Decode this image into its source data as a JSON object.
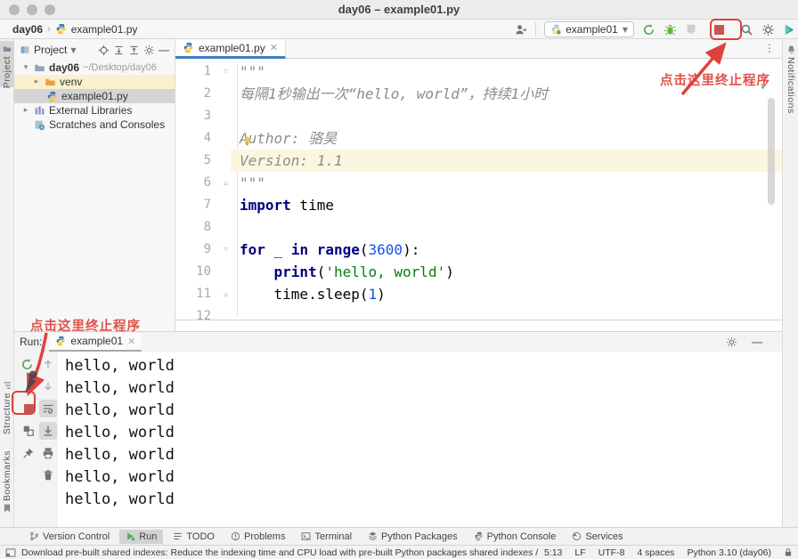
{
  "window": {
    "title": "day06 – example01.py"
  },
  "navbar": {
    "breadcrumb_project": "day06",
    "breadcrumb_file": "example01.py",
    "run_config": "example01"
  },
  "project_panel": {
    "title": "Project",
    "tree": [
      {
        "label": "day06",
        "path": "~/Desktop/day06"
      },
      {
        "label": "venv"
      },
      {
        "label": "example01.py"
      },
      {
        "label": "External Libraries"
      },
      {
        "label": "Scratches and Consoles"
      }
    ]
  },
  "tool_strips": {
    "left": [
      "Project",
      "Structure",
      "Bookmarks"
    ],
    "right": [
      "Notifications"
    ]
  },
  "editor": {
    "tab_title": "example01.py",
    "lines": [
      {
        "n": "1",
        "fold": "down",
        "segs": [
          [
            "\"\"\"",
            "str"
          ]
        ]
      },
      {
        "n": "2",
        "segs": [
          [
            "每隔1秒输出一次“hello, world”，持续1小时",
            "str"
          ]
        ]
      },
      {
        "n": "3",
        "segs": []
      },
      {
        "n": "4",
        "segs": [
          [
            "Author: 骆昊",
            "str"
          ]
        ]
      },
      {
        "n": "5",
        "hl": true,
        "segs": [
          [
            "Version: 1.1",
            "str"
          ]
        ]
      },
      {
        "n": "6",
        "fold": "up",
        "segs": [
          [
            "\"\"\"",
            "str"
          ]
        ]
      },
      {
        "n": "7",
        "segs": [
          [
            "import",
            "kw"
          ],
          [
            " time",
            "pl"
          ]
        ]
      },
      {
        "n": "8",
        "segs": []
      },
      {
        "n": "9",
        "fold": "down",
        "segs": [
          [
            "for",
            "kw"
          ],
          [
            " _ ",
            "pl"
          ],
          [
            "in",
            "kw"
          ],
          [
            " ",
            "pl"
          ],
          [
            "range",
            "kw"
          ],
          [
            "(",
            "pl"
          ],
          [
            "3600",
            "num"
          ],
          [
            "):",
            "pl"
          ]
        ]
      },
      {
        "n": "10",
        "segs": [
          [
            "    ",
            "pl"
          ],
          [
            "print",
            "kw"
          ],
          [
            "(",
            "pl"
          ],
          [
            "'hello, world'",
            "strg"
          ],
          [
            ")",
            "pl"
          ]
        ]
      },
      {
        "n": "11",
        "fold": "up",
        "segs": [
          [
            "    time.sleep(",
            "pl"
          ],
          [
            "1",
            "num"
          ],
          [
            ")",
            "pl"
          ]
        ]
      },
      {
        "n": "12",
        "segs": []
      }
    ]
  },
  "annotations": {
    "hint_top": "点击这里终止程序",
    "hint_bottom": "点击这里终止程序",
    "accent": "#e0413d"
  },
  "run_panel": {
    "label": "Run:",
    "tab_title": "example01",
    "console_lines": [
      "hello, world",
      "hello, world",
      "hello, world",
      "hello, world",
      "hello, world",
      "hello, world",
      "hello, world"
    ]
  },
  "bottom_bar": {
    "items": [
      "Version Control",
      "Run",
      "TODO",
      "Problems",
      "Terminal",
      "Python Packages",
      "Python Console",
      "Services"
    ],
    "active": "Run"
  },
  "status_bar": {
    "message": "Download pre-built shared indexes: Reduce the indexing time and CPU load with pre-built Python packages shared indexes // Always download... (a minute ago)",
    "caret": "5:13",
    "line_ending": "LF",
    "encoding": "UTF-8",
    "indent": "4 spaces",
    "interpreter": "Python 3.10 (day06)"
  }
}
